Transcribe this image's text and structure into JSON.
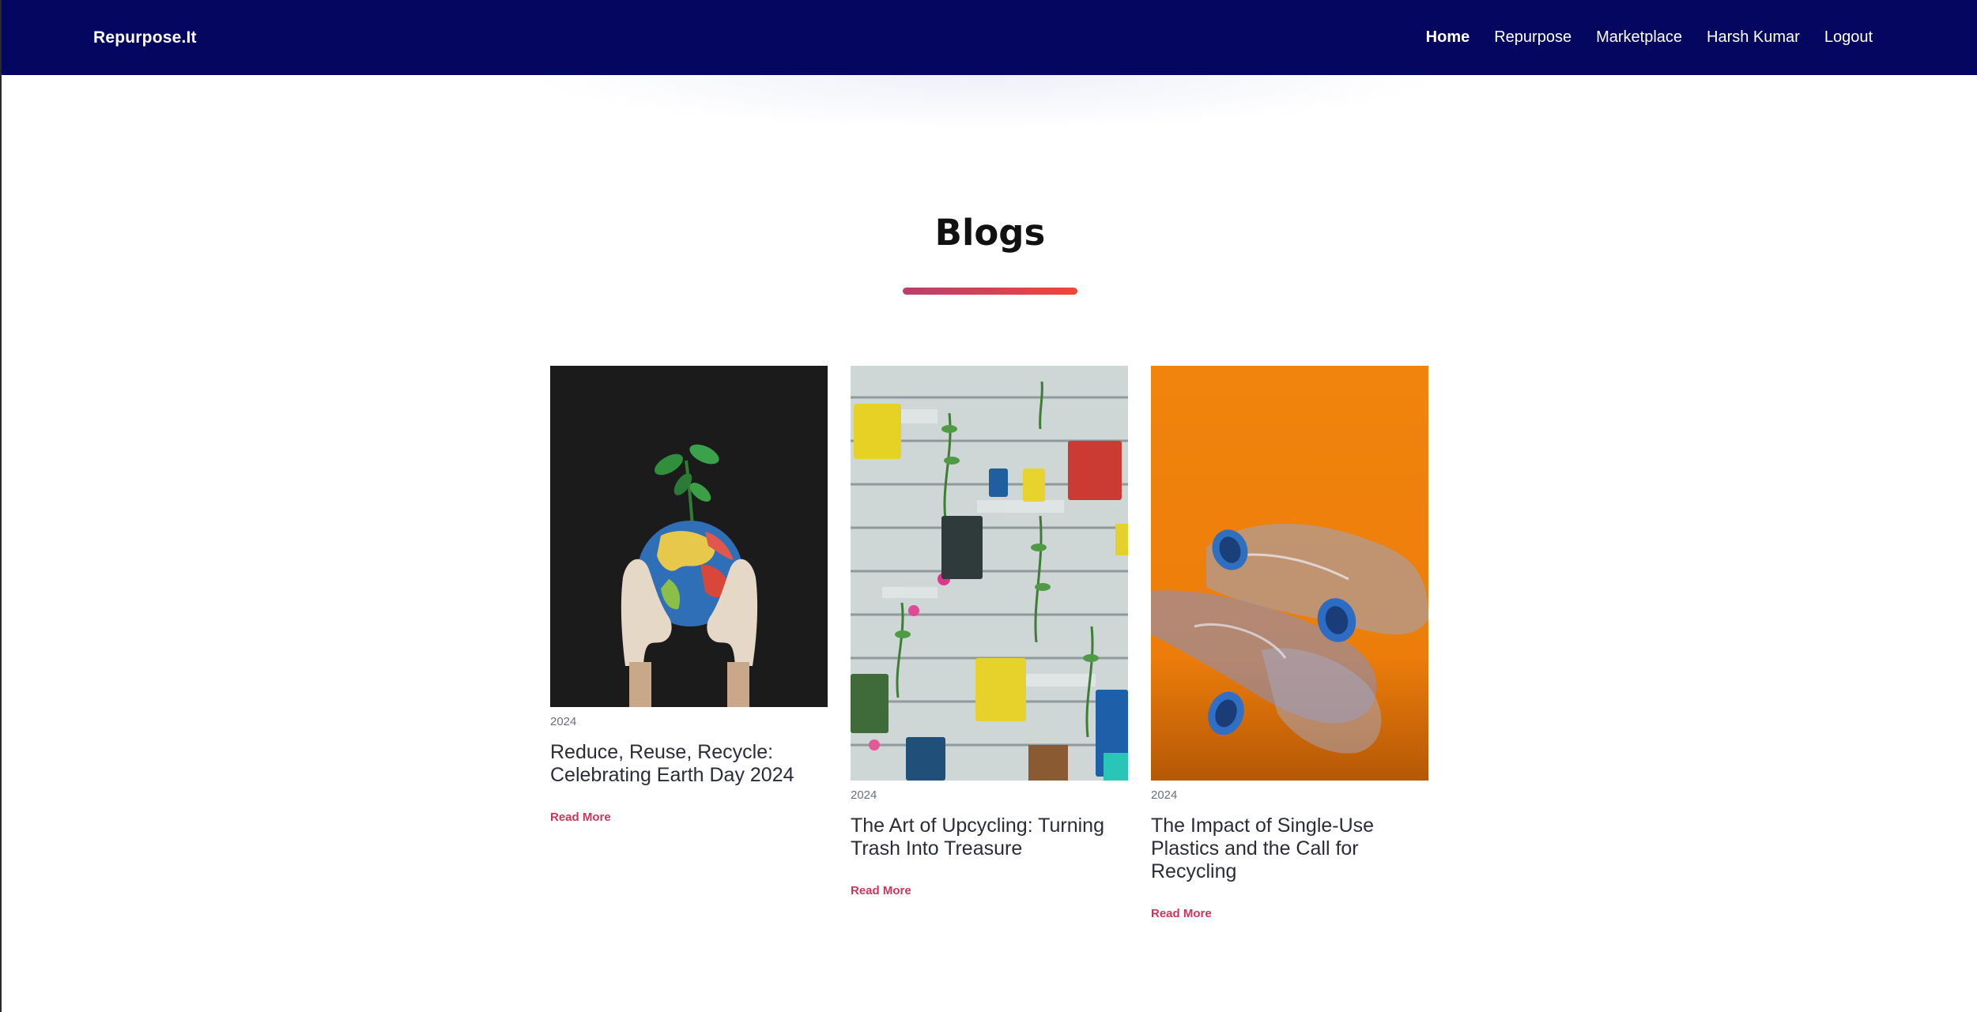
{
  "navbar": {
    "brand": "Repurpose.It",
    "links": [
      {
        "label": "Home",
        "active": true
      },
      {
        "label": "Repurpose"
      },
      {
        "label": "Marketplace"
      },
      {
        "label": "Harsh Kumar"
      },
      {
        "label": "Logout"
      }
    ]
  },
  "page": {
    "title": "Blogs"
  },
  "posts": [
    {
      "year": "2024",
      "title": "Reduce, Reuse, Recycle: Celebrating Earth Day 2024",
      "link": "Read More",
      "image": "globe-with-sprout-photo"
    },
    {
      "year": "2024",
      "title": "The Art of Upcycling: Turning Trash Into Treasure",
      "link": "Read More",
      "image": "tin-can-planters-photo"
    },
    {
      "year": "2024",
      "title": "The Impact of Single-Use Plastics and the Call for Recycling",
      "link": "Read More",
      "image": "plastic-bottles-photo"
    }
  ],
  "colors": {
    "navbar": "#050660",
    "accent": "#d1345b",
    "underline_start": "#b8406c",
    "underline_end": "#f0453c"
  }
}
